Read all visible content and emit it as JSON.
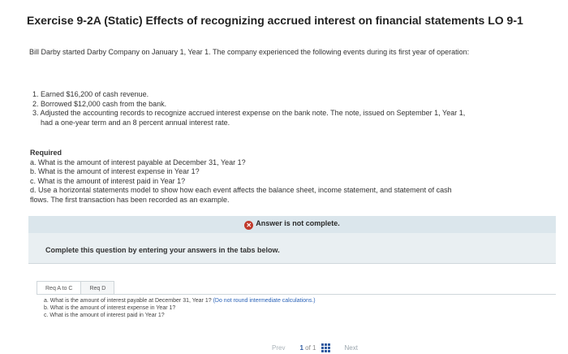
{
  "title": "Exercise 9-2A (Static) Effects of recognizing accrued interest on financial statements LO 9-1",
  "intro": "Bill Darby started Darby Company on January 1, Year 1. The company experienced the following events during its first year of operation:",
  "events": [
    {
      "num": "1.",
      "text": "Earned $16,200 of cash revenue."
    },
    {
      "num": "2.",
      "text": "Borrowed $12,000 cash from the bank."
    },
    {
      "num": "3.",
      "text": "Adjusted the accounting records to recognize accrued interest expense on the bank note. The note, issued on September 1, Year 1,",
      "cont": "had a one-year term and an 8 percent annual interest rate."
    }
  ],
  "required": {
    "heading": "Required",
    "items": [
      "a. What is the amount of interest payable at December 31, Year 1?",
      "b. What is the amount of interest expense in Year 1?",
      "c. What is the amount of interest paid in Year 1?",
      "d. Use a horizontal statements model to show how each event affects the balance sheet, income statement, and statement of cash",
      "flows. The first transaction has been recorded as an example."
    ]
  },
  "status": {
    "text": "Answer is not complete.",
    "icon": "x-circle-icon",
    "icon_color": "#c0392b"
  },
  "instruction": "Complete this question by entering your answers in the tabs below.",
  "tabs": [
    {
      "label": "Req A to C"
    },
    {
      "label": "Req D"
    }
  ],
  "panel": {
    "line_a": "a. What is the amount of interest payable at December 31, Year 1?",
    "line_a_note": "(Do not round intermediate calculations.)",
    "line_b": "b. What is the amount of interest expense in Year 1?",
    "line_c": "c. What is the amount of interest paid in Year 1?"
  },
  "pager": {
    "prev": "Prev",
    "current": "1",
    "of": "of",
    "total": "1",
    "next": "Next"
  }
}
